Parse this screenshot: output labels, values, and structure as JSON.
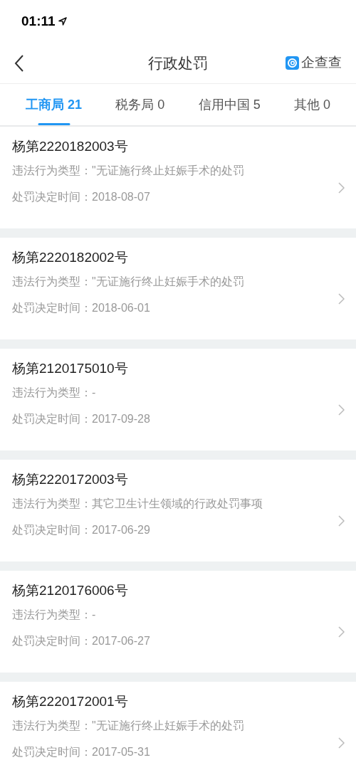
{
  "status_bar": {
    "time": "01:11"
  },
  "nav": {
    "title": "行政处罚",
    "brand": "企查查"
  },
  "tabs": [
    {
      "label": "工商局 21",
      "selected": true
    },
    {
      "label": "税务局 0",
      "selected": false
    },
    {
      "label": "信用中国 5",
      "selected": false
    },
    {
      "label": "其他 0",
      "selected": false
    }
  ],
  "records": [
    {
      "title": "杨第2220182003号",
      "type": "违法行为类型：\"无证施行终止妊娠手术的处罚",
      "date": "处罚决定时间：2018-08-07"
    },
    {
      "title": "杨第2220182002号",
      "type": "违法行为类型：\"无证施行终止妊娠手术的处罚",
      "date": "处罚决定时间：2018-06-01"
    },
    {
      "title": "杨第2120175010号",
      "type": "违法行为类型：-",
      "date": "处罚决定时间：2017-09-28"
    },
    {
      "title": "杨第2220172003号",
      "type": "违法行为类型：其它卫生计生领域的行政处罚事项",
      "date": "处罚决定时间：2017-06-29"
    },
    {
      "title": "杨第2120176006号",
      "type": "违法行为类型：-",
      "date": "处罚决定时间：2017-06-27"
    },
    {
      "title": "杨第2220172001号",
      "type": "违法行为类型：\"无证施行终止妊娠手术的处罚",
      "date": "处罚决定时间：2017-05-31"
    }
  ]
}
